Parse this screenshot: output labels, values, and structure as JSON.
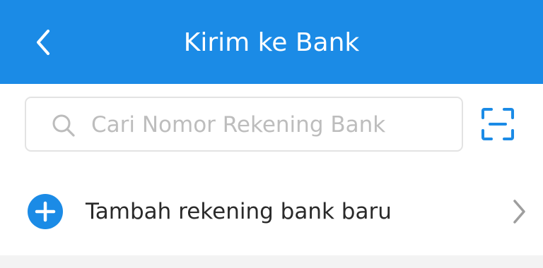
{
  "header": {
    "title": "Kirim ke Bank",
    "back_icon": "chevron-left-icon",
    "background_color": "#1b8be6"
  },
  "search": {
    "placeholder": "Cari Nomor Rekening Bank",
    "value": "",
    "icon": "search-icon"
  },
  "scan": {
    "icon": "scan-icon",
    "color": "#1b8be6"
  },
  "add_account": {
    "label": "Tambah rekening bank baru",
    "icon": "plus-circle-icon",
    "chevron": "chevron-right-icon"
  }
}
